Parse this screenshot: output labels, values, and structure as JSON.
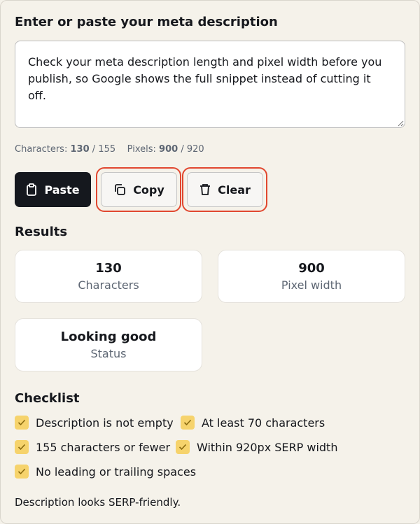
{
  "input": {
    "heading": "Enter or paste your meta description",
    "value": "Check your meta description length and pixel width before you publish, so Google shows the full snippet instead of cutting it off."
  },
  "counts": {
    "characters_label": "Characters:",
    "characters_value": "130",
    "characters_max": "155",
    "pixels_label": "Pixels:",
    "pixels_value": "900",
    "pixels_max": "920",
    "separator": "/"
  },
  "actions": {
    "paste_label": "Paste",
    "copy_label": "Copy",
    "clear_label": "Clear"
  },
  "results": {
    "heading": "Results",
    "cards": [
      {
        "value": "130",
        "label": "Characters"
      },
      {
        "value": "900",
        "label": "Pixel width"
      },
      {
        "value": "Looking good",
        "label": "Status"
      }
    ]
  },
  "checklist": {
    "heading": "Checklist",
    "items": [
      {
        "label": "Description is not empty",
        "checked": true
      },
      {
        "label": "At least 70 characters",
        "checked": true
      },
      {
        "label": "155 characters or fewer",
        "checked": true
      },
      {
        "label": "Within 920px SERP width",
        "checked": true
      },
      {
        "label": "No leading or trailing spaces",
        "checked": true
      }
    ]
  },
  "summary": "Description looks SERP-friendly.",
  "colors": {
    "background": "#f5f2ea",
    "primary_button": "#15181e",
    "highlight_ring": "#e1472f",
    "checkbox": "#f6d36c",
    "muted_text": "#5d6673"
  }
}
